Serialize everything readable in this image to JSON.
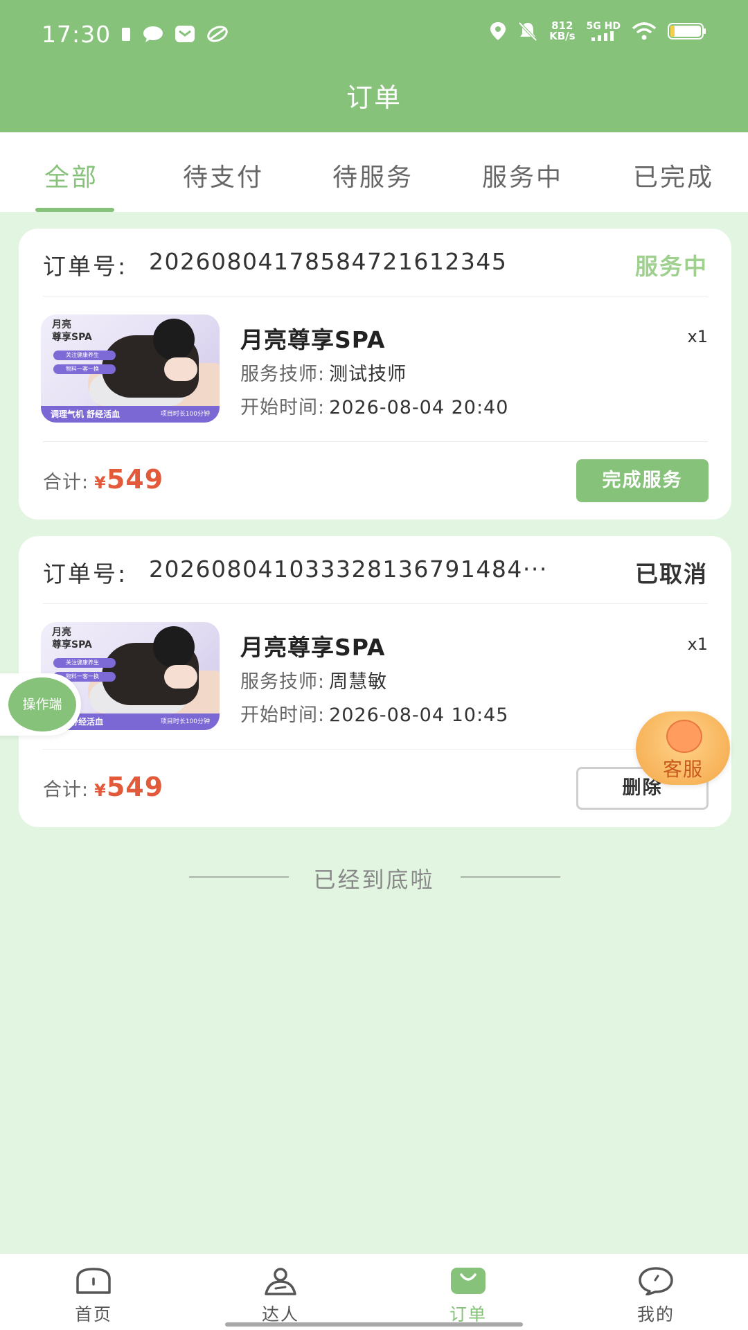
{
  "status_bar": {
    "time": "17:30",
    "net_speed_value": "812",
    "net_speed_unit": "KB/s",
    "net_type": "5G HD",
    "icons": [
      "battery-saver-icon",
      "chat-icon",
      "mail-icon",
      "leaf-icon",
      "location-icon",
      "mute-icon",
      "signal-icon",
      "wifi-icon",
      "battery-icon"
    ]
  },
  "header": {
    "title": "订单"
  },
  "tabs": [
    {
      "label": "全部",
      "active": true
    },
    {
      "label": "待支付",
      "active": false
    },
    {
      "label": "待服务",
      "active": false
    },
    {
      "label": "服务中",
      "active": false
    },
    {
      "label": "已完成",
      "active": false
    }
  ],
  "orders": [
    {
      "order_label": "订单号:",
      "order_no": "20260804178584721612345",
      "status": "服务中",
      "status_color": "#9fd08f",
      "product_name": "月亮尊享SPA",
      "qty": "x1",
      "tech_label": "服务技师:",
      "tech_value": "测试技师",
      "time_label": "开始时间:",
      "time_value": "2026-08-04 20:40",
      "total_label": "合计:",
      "currency": "¥",
      "amount": "549",
      "action": "完成服务",
      "thumb": {
        "title": "月亮\n尊享SPA",
        "chip1": "关注健康养生",
        "chip2": "物料一客一换",
        "bar_left": "调理气机  舒经活血",
        "bar_right": "项目时长100分钟"
      }
    },
    {
      "order_label": "订单号:",
      "order_no": "2026080410333281367914​84···",
      "status": "已取消",
      "status_color": "#333333",
      "product_name": "月亮尊享SPA",
      "qty": "x1",
      "tech_label": "服务技师:",
      "tech_value": "周慧敏",
      "time_label": "开始时间:",
      "time_value": "2026-08-04 10:45",
      "total_label": "合计:",
      "currency": "¥",
      "amount": "549",
      "action": "删除",
      "thumb": {
        "title": "月亮\n尊享SPA",
        "chip1": "关注健康养生",
        "chip2": "物料一客一换",
        "bar_left": "气机  舒经活血",
        "bar_right": "项目时长100分钟"
      }
    }
  ],
  "end_text": "已经到底啦",
  "floating": {
    "operator_label": "操作端",
    "service_label": "客服"
  },
  "bottom_nav": [
    {
      "label": "首页",
      "icon": "home-icon",
      "active": false
    },
    {
      "label": "达人",
      "icon": "person-icon",
      "active": false
    },
    {
      "label": "订单",
      "icon": "order-bag-icon",
      "active": true
    },
    {
      "label": "我的",
      "icon": "profile-chat-icon",
      "active": false
    }
  ],
  "colors": {
    "brand": "#86c27a",
    "page_bg": "#e2f5e1",
    "price": "#e35a3a"
  }
}
